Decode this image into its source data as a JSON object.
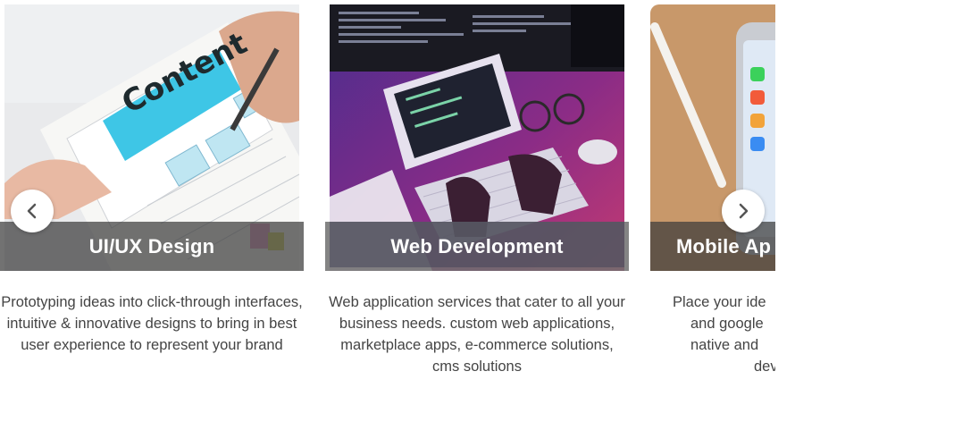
{
  "carousel": {
    "cards": [
      {
        "title": "UI/UX Design",
        "description": "Prototyping ideas into click-through interfaces, intuitive & innovative designs to bring in best user experience to represent your brand",
        "image_text": "Content"
      },
      {
        "title": "Web Development",
        "description": "Web application services that cater to all your business needs. custom web applications, marketplace apps, e-commerce solutions, cms solutions"
      },
      {
        "title": "Mobile Ap",
        "description_lines": [
          "Place your ide",
          "and google",
          "native and",
          "dev"
        ]
      }
    ],
    "prev_icon": "chevron-left-icon",
    "next_icon": "chevron-right-icon"
  }
}
